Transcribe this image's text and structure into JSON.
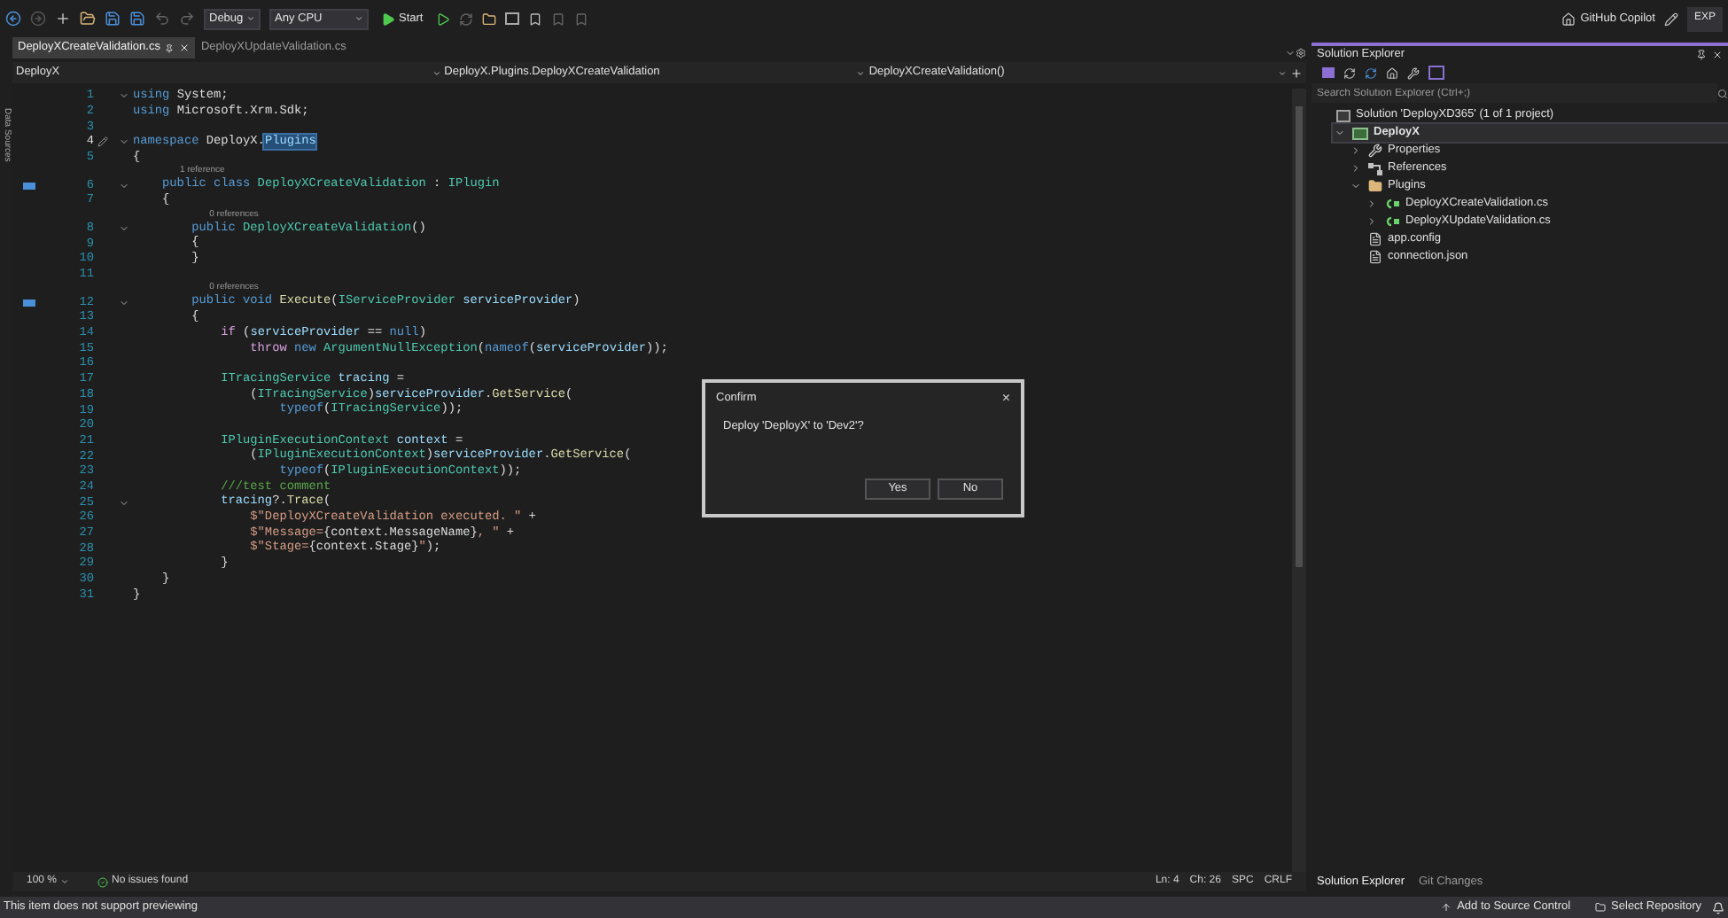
{
  "toolbar": {
    "configuration": "Debug",
    "platform": "Any CPU",
    "start": "Start",
    "copilot": "GitHub Copilot",
    "badge": "EXP"
  },
  "side_strip": {
    "label": "Data Sources"
  },
  "tabs": [
    {
      "label": "DeployXCreateValidation.cs",
      "selected": true
    },
    {
      "label": "DeployXUpdateValidation.cs",
      "selected": false
    }
  ],
  "nav_bar": {
    "project": "DeployX",
    "type": "DeployX.Plugins.DeployXCreateValidation",
    "member": "DeployXCreateValidation()"
  },
  "code": [
    {
      "number": "1",
      "fold": true,
      "tokens": [
        {
          "kind": "kw",
          "text": "using"
        },
        {
          "kind": "plain",
          "text": " System;"
        }
      ]
    },
    {
      "number": "2",
      "tokens": [
        {
          "kind": "kw",
          "text": "using"
        },
        {
          "kind": "plain",
          "text": " Microsoft.Xrm.Sdk;"
        }
      ]
    },
    {
      "number": "3"
    },
    {
      "number": "4",
      "fold": true,
      "current": true,
      "tokens": [
        {
          "kind": "kw",
          "text": "namespace"
        },
        {
          "kind": "plain",
          "text": " DeployX."
        },
        {
          "kind": "sel",
          "text": "Plugins"
        }
      ]
    },
    {
      "number": "5",
      "tokens": [
        {
          "kind": "plain",
          "text": "{"
        }
      ]
    },
    {
      "number": "6",
      "fold": true,
      "implements": true,
      "codelens": "1 reference",
      "tokens": [
        {
          "kind": "kw",
          "text": "    public class"
        },
        {
          "kind": "type",
          "text": " DeployXCreateValidation"
        },
        {
          "kind": "plain",
          "text": " : "
        },
        {
          "kind": "type",
          "text": "IPlugin"
        }
      ]
    },
    {
      "number": "7",
      "tokens": [
        {
          "kind": "plain",
          "text": "    {"
        }
      ]
    },
    {
      "number": "8",
      "fold": true,
      "codelens": "0 references",
      "tokens": [
        {
          "kind": "kw",
          "text": "        public"
        },
        {
          "kind": "type",
          "text": " DeployXCreateValidation"
        },
        {
          "kind": "plain",
          "text": "()"
        }
      ]
    },
    {
      "number": "9",
      "tokens": [
        {
          "kind": "plain",
          "text": "        {"
        }
      ]
    },
    {
      "number": "10",
      "tokens": [
        {
          "kind": "plain",
          "text": "        }"
        }
      ]
    },
    {
      "number": "11"
    },
    {
      "number": "12",
      "fold": true,
      "implements": true,
      "codelens": "0 references",
      "tokens": [
        {
          "kind": "kw",
          "text": "        public void"
        },
        {
          "kind": "method",
          "text": " Execute"
        },
        {
          "kind": "plain",
          "text": "("
        },
        {
          "kind": "type",
          "text": "IServiceProvider"
        },
        {
          "kind": "param",
          "text": " serviceProvider"
        },
        {
          "kind": "plain",
          "text": ")"
        }
      ]
    },
    {
      "number": "13",
      "tokens": [
        {
          "kind": "plain",
          "text": "        {"
        }
      ]
    },
    {
      "number": "14",
      "tokens": [
        {
          "kind": "ctrl",
          "text": "            if"
        },
        {
          "kind": "plain",
          "text": " ("
        },
        {
          "kind": "param",
          "text": "serviceProvider"
        },
        {
          "kind": "plain",
          "text": " == "
        },
        {
          "kind": "kw",
          "text": "null"
        },
        {
          "kind": "plain",
          "text": ")"
        }
      ]
    },
    {
      "number": "15",
      "tokens": [
        {
          "kind": "ctrl",
          "text": "                throw"
        },
        {
          "kind": "kw",
          "text": " new"
        },
        {
          "kind": "type",
          "text": " ArgumentNullException"
        },
        {
          "kind": "plain",
          "text": "("
        },
        {
          "kind": "kw",
          "text": "nameof"
        },
        {
          "kind": "plain",
          "text": "("
        },
        {
          "kind": "param",
          "text": "serviceProvider"
        },
        {
          "kind": "plain",
          "text": "));"
        }
      ]
    },
    {
      "number": "16"
    },
    {
      "number": "17",
      "tokens": [
        {
          "kind": "type",
          "text": "            ITracingService"
        },
        {
          "kind": "param",
          "text": " tracing"
        },
        {
          "kind": "plain",
          "text": " ="
        }
      ]
    },
    {
      "number": "18",
      "tokens": [
        {
          "kind": "plain",
          "text": "                ("
        },
        {
          "kind": "type",
          "text": "ITracingService"
        },
        {
          "kind": "plain",
          "text": ")"
        },
        {
          "kind": "param",
          "text": "serviceProvider"
        },
        {
          "kind": "plain",
          "text": "."
        },
        {
          "kind": "method",
          "text": "GetService"
        },
        {
          "kind": "plain",
          "text": "("
        }
      ]
    },
    {
      "number": "19",
      "tokens": [
        {
          "kind": "kw",
          "text": "                    typeof"
        },
        {
          "kind": "plain",
          "text": "("
        },
        {
          "kind": "type",
          "text": "ITracingService"
        },
        {
          "kind": "plain",
          "text": "));"
        }
      ]
    },
    {
      "number": "20"
    },
    {
      "number": "21",
      "tokens": [
        {
          "kind": "type",
          "text": "            IPluginExecutionContext"
        },
        {
          "kind": "param",
          "text": " context"
        },
        {
          "kind": "plain",
          "text": " ="
        }
      ]
    },
    {
      "number": "22",
      "tokens": [
        {
          "kind": "plain",
          "text": "                ("
        },
        {
          "kind": "type",
          "text": "IPluginExecutionContext"
        },
        {
          "kind": "plain",
          "text": ")"
        },
        {
          "kind": "param",
          "text": "serviceProvider"
        },
        {
          "kind": "plain",
          "text": "."
        },
        {
          "kind": "method",
          "text": "GetService"
        },
        {
          "kind": "plain",
          "text": "("
        }
      ]
    },
    {
      "number": "23",
      "tokens": [
        {
          "kind": "kw",
          "text": "                    typeof"
        },
        {
          "kind": "plain",
          "text": "("
        },
        {
          "kind": "type",
          "text": "IPluginExecutionContext"
        },
        {
          "kind": "plain",
          "text": "));"
        }
      ]
    },
    {
      "number": "24",
      "tokens": [
        {
          "kind": "comment",
          "text": "            ///test comment"
        }
      ]
    },
    {
      "number": "25",
      "fold": true,
      "tokens": [
        {
          "kind": "param",
          "text": "            tracing"
        },
        {
          "kind": "plain",
          "text": "?."
        },
        {
          "kind": "method",
          "text": "Trace"
        },
        {
          "kind": "plain",
          "text": "("
        }
      ]
    },
    {
      "number": "26",
      "tokens": [
        {
          "kind": "str",
          "text": "                $\"DeployXCreateValidation executed. \""
        },
        {
          "kind": "plain",
          "text": " +"
        }
      ]
    },
    {
      "number": "27",
      "tokens": [
        {
          "kind": "str",
          "text": "                $\"Message="
        },
        {
          "kind": "plain",
          "text": "{context.MessageName}"
        },
        {
          "kind": "str",
          "text": ", \""
        },
        {
          "kind": "plain",
          "text": " +"
        }
      ]
    },
    {
      "number": "28",
      "tokens": [
        {
          "kind": "str",
          "text": "                $\"Stage="
        },
        {
          "kind": "plain",
          "text": "{context.Stage}"
        },
        {
          "kind": "str",
          "text": "\""
        },
        {
          "kind": "plain",
          "text": ");"
        }
      ]
    },
    {
      "number": "29",
      "tokens": [
        {
          "kind": "plain",
          "text": "            }"
        }
      ]
    },
    {
      "number": "30",
      "tokens": [
        {
          "kind": "plain",
          "text": "    }"
        }
      ]
    },
    {
      "number": "31",
      "tokens": [
        {
          "kind": "plain",
          "text": "}"
        }
      ]
    }
  ],
  "editor_status": {
    "zoom": "100 %",
    "issues": "No issues found",
    "line": "Ln: 4",
    "column": "Ch: 26",
    "indent": "SPC",
    "line_ending": "CRLF"
  },
  "dialog": {
    "title": "Confirm",
    "close": "×",
    "message": "Deploy 'DeployX' to 'Dev2'?",
    "buttons": [
      "Yes",
      "No"
    ]
  },
  "solution_explorer": {
    "title": "Solution Explorer",
    "search": {
      "placeholder": "Search Solution Explorer (Ctrl+;)"
    },
    "tree": [
      {
        "label": "Solution 'DeployXD365' (1 of 1 project)",
        "kind": "solution",
        "selected": false,
        "children": [
          {
            "label": "DeployX",
            "kind": "project",
            "expanded": true,
            "selected": true,
            "children": [
              {
                "label": "Properties",
                "kind": "properties",
                "expanded": false,
                "selected": false
              },
              {
                "label": "References",
                "kind": "references",
                "expanded": false,
                "selected": false
              },
              {
                "label": "Plugins",
                "kind": "folder",
                "expanded": true,
                "selected": false,
                "children": [
                  {
                    "label": "DeployXCreateValidation.cs",
                    "kind": "csharp",
                    "expanded": false,
                    "selected": false
                  },
                  {
                    "label": "DeployXUpdateValidation.cs",
                    "kind": "csharp",
                    "expanded": false,
                    "selected": false
                  }
                ]
              },
              {
                "label": "app.config",
                "kind": "config",
                "selected": false
              },
              {
                "label": "connection.json",
                "kind": "file",
                "selected": false
              }
            ]
          }
        ]
      }
    ],
    "bottom_tabs": [
      {
        "label": "Solution Explorer",
        "selected": true
      },
      {
        "label": "Git Changes",
        "selected": false
      }
    ]
  },
  "status_bar": {
    "message": "This item does not support previewing",
    "source_control": "Add to Source Control",
    "repository": "Select Repository"
  }
}
